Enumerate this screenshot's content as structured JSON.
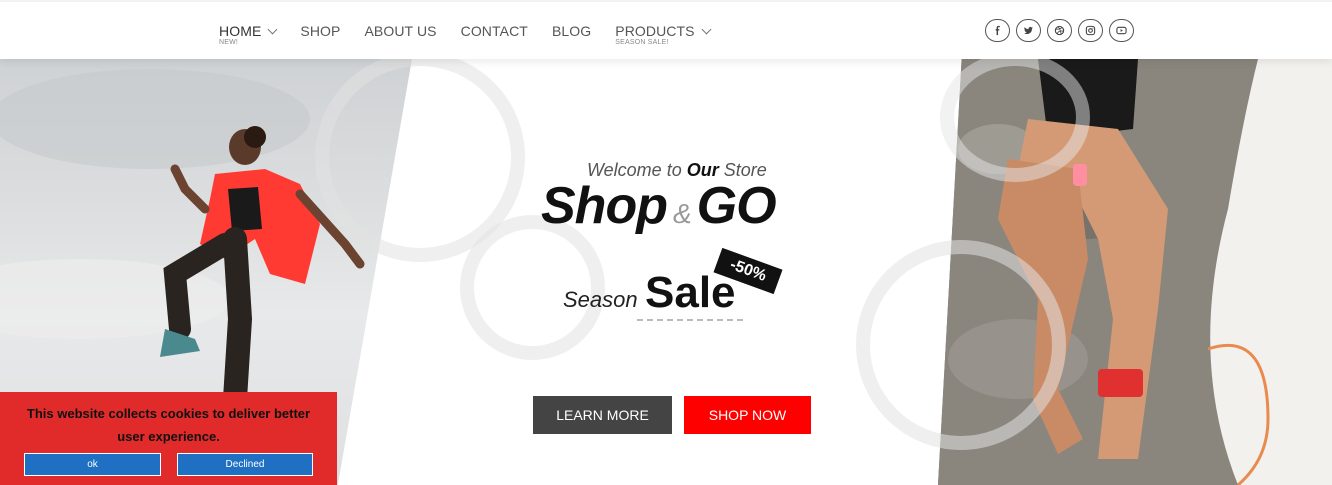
{
  "nav": {
    "items": [
      {
        "label": "HOME",
        "sub": "NEW!"
      },
      {
        "label": "SHOP"
      },
      {
        "label": "ABOUT US"
      },
      {
        "label": "CONTACT"
      },
      {
        "label": "BLOG"
      },
      {
        "label": "PRODUCTS",
        "sub": "SEASON SALE!"
      }
    ]
  },
  "socials": [
    "facebook-icon",
    "twitter-icon",
    "dribbble-icon",
    "instagram-icon",
    "youtube-icon"
  ],
  "hero": {
    "welcome_pre": "Welcome to ",
    "welcome_our": "Our",
    "welcome_post": " Store",
    "brand_a": "Shop",
    "brand_amp": "&",
    "brand_b": "GO",
    "season": "Season",
    "sale": "Sale",
    "badge": "-50%",
    "learn_more": "LEARN MORE",
    "shop_now": "SHOP NOW"
  },
  "cookie": {
    "message": "This website collects cookies to deliver better user experience.",
    "ok": "ok",
    "declined": "Declined"
  },
  "colors": {
    "accent": "#ff0000",
    "cookie_bg": "#e12a2a",
    "cookie_button": "#1f6fc3",
    "dark_button": "#444444"
  }
}
